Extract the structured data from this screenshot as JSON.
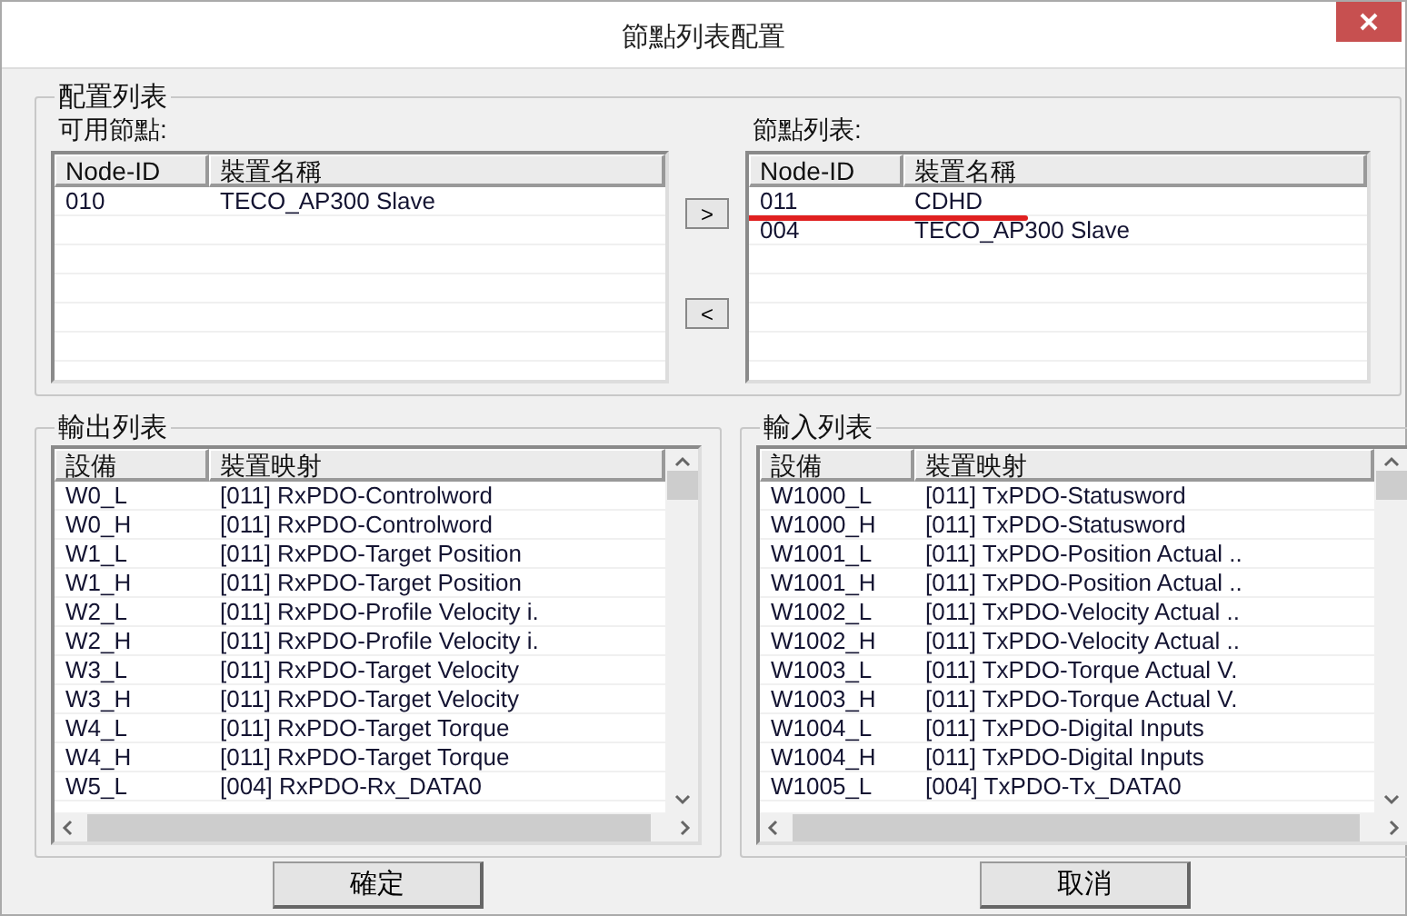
{
  "window": {
    "title": "節點列表配置"
  },
  "config_group": {
    "title": "配置列表",
    "available": {
      "label": "可用節點:",
      "columns": [
        "Node-ID",
        "裝置名稱"
      ],
      "rows": [
        [
          "010",
          "TECO_AP300 Slave"
        ]
      ]
    },
    "move_buttons": [
      ">",
      "<"
    ],
    "nodes": {
      "label": "節點列表:",
      "columns": [
        "Node-ID",
        "裝置名稱"
      ],
      "rows": [
        [
          "011",
          "CDHD"
        ],
        [
          "004",
          "TECO_AP300 Slave"
        ]
      ]
    }
  },
  "output_group": {
    "title": "輸出列表",
    "columns": [
      "設備",
      "裝置映射"
    ],
    "rows": [
      [
        "W0_L",
        "[011] RxPDO-Controlword"
      ],
      [
        "W0_H",
        "[011] RxPDO-Controlword"
      ],
      [
        "W1_L",
        "[011] RxPDO-Target Position"
      ],
      [
        "W1_H",
        "[011] RxPDO-Target Position"
      ],
      [
        "W2_L",
        "[011] RxPDO-Profile Velocity i."
      ],
      [
        "W2_H",
        "[011] RxPDO-Profile Velocity i."
      ],
      [
        "W3_L",
        "[011] RxPDO-Target Velocity"
      ],
      [
        "W3_H",
        "[011] RxPDO-Target Velocity"
      ],
      [
        "W4_L",
        "[011] RxPDO-Target Torque"
      ],
      [
        "W4_H",
        "[011] RxPDO-Target Torque"
      ],
      [
        "W5_L",
        "[004] RxPDO-Rx_DATA0"
      ]
    ]
  },
  "input_group": {
    "title": "輸入列表",
    "columns": [
      "設備",
      "裝置映射"
    ],
    "rows": [
      [
        "W1000_L",
        "[011] TxPDO-Statusword"
      ],
      [
        "W1000_H",
        "[011] TxPDO-Statusword"
      ],
      [
        "W1001_L",
        "[011] TxPDO-Position Actual .."
      ],
      [
        "W1001_H",
        "[011] TxPDO-Position Actual .."
      ],
      [
        "W1002_L",
        "[011] TxPDO-Velocity Actual .."
      ],
      [
        "W1002_H",
        "[011] TxPDO-Velocity Actual .."
      ],
      [
        "W1003_L",
        "[011] TxPDO-Torque Actual V."
      ],
      [
        "W1003_H",
        "[011] TxPDO-Torque Actual V."
      ],
      [
        "W1004_L",
        "[011] TxPDO-Digital Inputs"
      ],
      [
        "W1004_H",
        "[011] TxPDO-Digital Inputs"
      ],
      [
        "W1005_L",
        "[004] TxPDO-Tx_DATA0"
      ]
    ]
  },
  "buttons": [
    "確定",
    "取消"
  ]
}
